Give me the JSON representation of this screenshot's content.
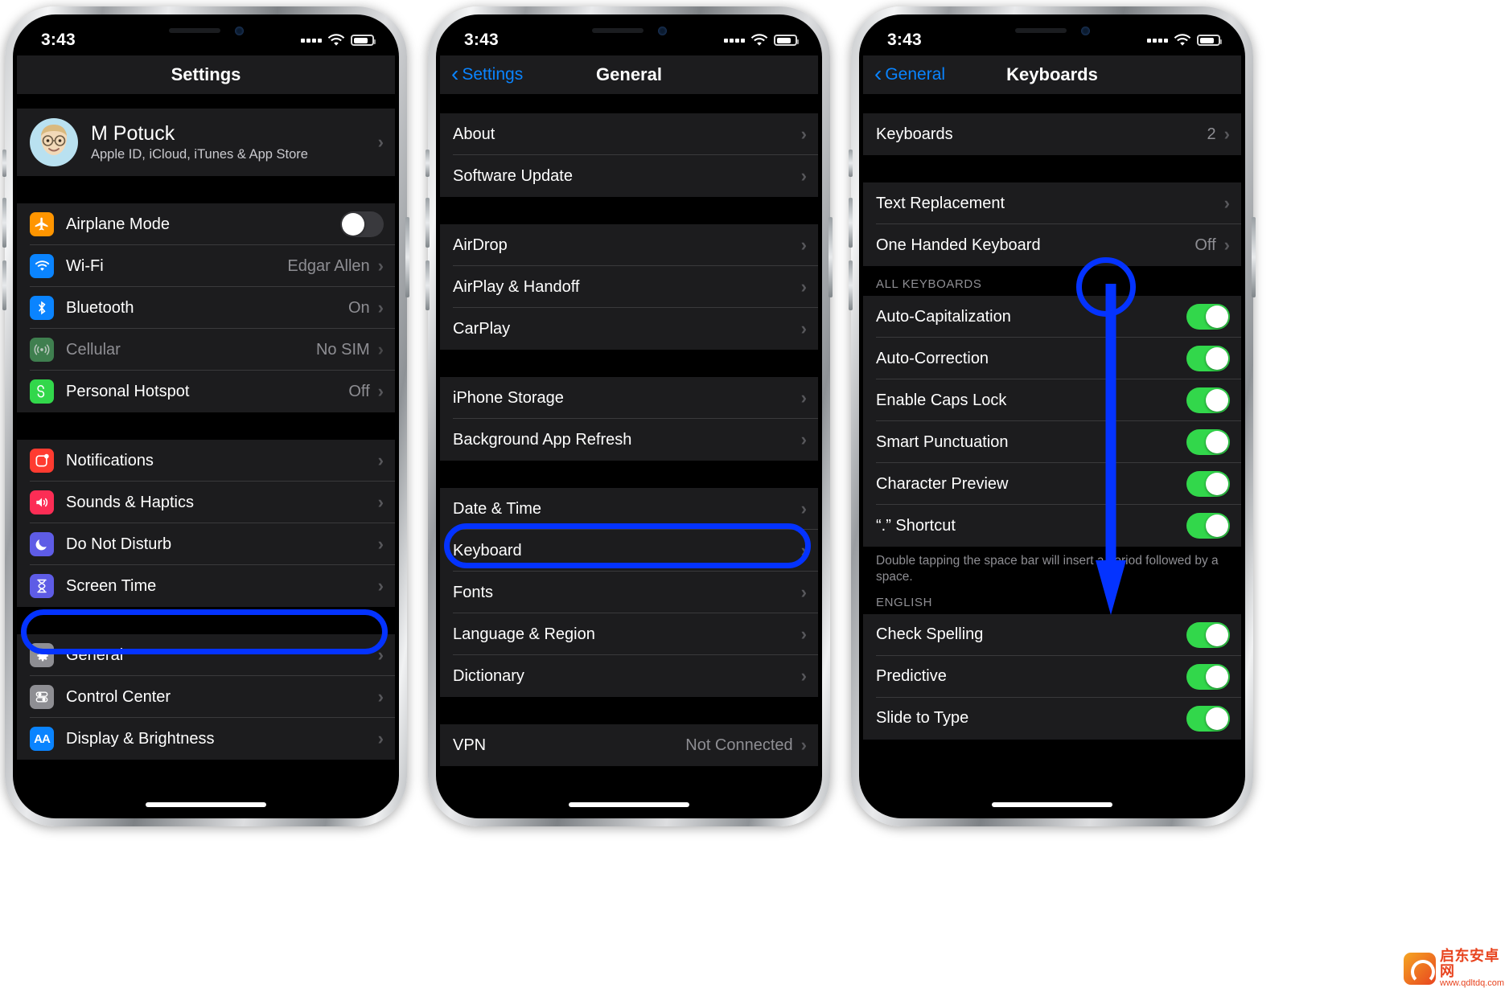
{
  "colors": {
    "accent_blue": "#0a84ff",
    "annotation_blue": "#0433ff",
    "toggle_on_green": "#32d74b",
    "row_bg": "#1c1c1e",
    "screen_bg": "#000000",
    "secondary_text": "#8e8e93"
  },
  "phone1": {
    "status": {
      "time": "3:43",
      "battery_icon": "battery-icon",
      "wifi_icon": "wifi-icon",
      "signal_icon": "signal-dots-icon"
    },
    "nav": {
      "title": "Settings"
    },
    "account": {
      "name": "M Potuck",
      "subtitle": "Apple ID, iCloud, iTunes & App Store",
      "avatar_icon": "memoji-avatar"
    },
    "group1": [
      {
        "label": "Airplane Mode",
        "icon": "airplane-icon",
        "icon_color": "#ff9500",
        "control": "toggle",
        "toggle_state": "off"
      },
      {
        "label": "Wi-Fi",
        "icon": "wifi-icon",
        "icon_color": "#0a84ff",
        "value": "Edgar Allen",
        "control": "chevron"
      },
      {
        "label": "Bluetooth",
        "icon": "bluetooth-icon",
        "icon_color": "#0a84ff",
        "value": "On",
        "control": "chevron"
      },
      {
        "label": "Cellular",
        "icon": "cellular-icon",
        "icon_color": "#3f7f4f",
        "value": "No SIM",
        "control": "chevron",
        "disabled": true
      },
      {
        "label": "Personal Hotspot",
        "icon": "hotspot-icon",
        "icon_color": "#32d74b",
        "value": "Off",
        "control": "chevron"
      }
    ],
    "group2": [
      {
        "label": "Notifications",
        "icon": "notifications-icon",
        "icon_color": "#ff3b30",
        "control": "chevron"
      },
      {
        "label": "Sounds & Haptics",
        "icon": "sounds-icon",
        "icon_color": "#fc2d55",
        "control": "chevron"
      },
      {
        "label": "Do Not Disturb",
        "icon": "moon-icon",
        "icon_color": "#5e5ce6",
        "control": "chevron"
      },
      {
        "label": "Screen Time",
        "icon": "hourglass-icon",
        "icon_color": "#5e5ce6",
        "control": "chevron"
      }
    ],
    "group3": [
      {
        "label": "General",
        "icon": "gear-icon",
        "icon_color": "#8e8e93",
        "control": "chevron",
        "highlighted": true
      },
      {
        "label": "Control Center",
        "icon": "control-center-icon",
        "icon_color": "#8e8e93",
        "control": "chevron"
      },
      {
        "label": "Display & Brightness",
        "icon": "display-brightness-icon",
        "icon_color": "#0a84ff",
        "control": "chevron"
      }
    ]
  },
  "phone2": {
    "status": {
      "time": "3:43"
    },
    "nav": {
      "back_label": "Settings",
      "title": "General"
    },
    "group1": [
      {
        "label": "About"
      },
      {
        "label": "Software Update"
      }
    ],
    "group2": [
      {
        "label": "AirDrop"
      },
      {
        "label": "AirPlay & Handoff"
      },
      {
        "label": "CarPlay"
      }
    ],
    "group3": [
      {
        "label": "iPhone Storage"
      },
      {
        "label": "Background App Refresh"
      }
    ],
    "group4": [
      {
        "label": "Date & Time"
      },
      {
        "label": "Keyboard",
        "highlighted": true
      },
      {
        "label": "Fonts"
      },
      {
        "label": "Language & Region"
      },
      {
        "label": "Dictionary"
      }
    ],
    "group5": [
      {
        "label": "VPN",
        "value": "Not Connected"
      }
    ]
  },
  "phone3": {
    "status": {
      "time": "3:43"
    },
    "nav": {
      "back_label": "General",
      "title": "Keyboards"
    },
    "group1": [
      {
        "label": "Keyboards",
        "value": "2"
      }
    ],
    "group2": [
      {
        "label": "Text Replacement"
      },
      {
        "label": "One Handed Keyboard",
        "value": "Off"
      }
    ],
    "all_keyboards_header": "ALL KEYBOARDS",
    "all_keyboards": [
      {
        "label": "Auto-Capitalization",
        "toggle_state": "on"
      },
      {
        "label": "Auto-Correction",
        "toggle_state": "on"
      },
      {
        "label": "Enable Caps Lock",
        "toggle_state": "on"
      },
      {
        "label": "Smart Punctuation",
        "toggle_state": "on"
      },
      {
        "label": "Character Preview",
        "toggle_state": "on"
      },
      {
        "label": "“.” Shortcut",
        "toggle_state": "on"
      }
    ],
    "footer": "Double tapping the space bar will insert a period followed by a space.",
    "english_header": "ENGLISH",
    "english": [
      {
        "label": "Check Spelling",
        "toggle_state": "on"
      },
      {
        "label": "Predictive",
        "toggle_state": "on"
      },
      {
        "label": "Slide to Type",
        "toggle_state": "on"
      }
    ]
  },
  "watermark": {
    "brand": "启东安卓网",
    "url": "www.qdltdq.com"
  }
}
